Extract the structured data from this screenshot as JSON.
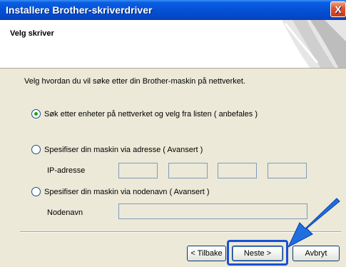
{
  "window": {
    "title": "Installere Brother-skriverdriver",
    "close_glyph": "X"
  },
  "header": {
    "title": "Velg skriver"
  },
  "instruction": "Velg hvordan du vil søke etter din Brother-maskin på nettverket.",
  "options": [
    {
      "label": "Søk etter enheter på nettverket og velg fra listen ( anbefales )",
      "checked": true
    },
    {
      "label": "Spesifiser din maskin via adresse ( Avansert )",
      "checked": false
    },
    {
      "label": "Spesifiser din maskin via nodenavn  ( Avansert )",
      "checked": false
    }
  ],
  "fields": {
    "ip_label": "IP-adresse",
    "ip_octets": [
      "",
      "",
      "",
      ""
    ],
    "node_label": "Nodenavn",
    "node_value": ""
  },
  "buttons": {
    "back": "< Tilbake",
    "next": "Neste >",
    "cancel": "Avbryt"
  },
  "colors": {
    "arrow": "#1f6fe0",
    "highlight": "#1a4fd6",
    "titlebar": "#0550d6"
  }
}
